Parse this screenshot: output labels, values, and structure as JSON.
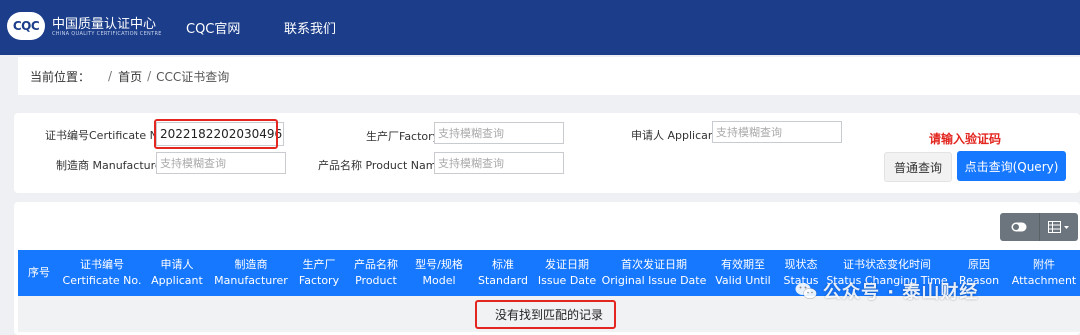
{
  "brand": {
    "logo_text": "CQC",
    "name_cn": "中国质量认证中心",
    "name_en": "CHINA QUALITY CERTIFICATION CENTRE"
  },
  "nav": {
    "items": [
      {
        "label": "CQC官网"
      },
      {
        "label": "联系我们"
      }
    ]
  },
  "breadcrumb": {
    "prefix": "当前位置：",
    "home": "首页",
    "current": "CCC证书查询"
  },
  "form": {
    "cert_no": {
      "label": "证书编号Certificate No.",
      "value": "2022182202030496"
    },
    "factory": {
      "label": "生产厂Factory:",
      "placeholder": "支持模糊查询"
    },
    "applicant": {
      "label": "申请人 Applicant:",
      "placeholder": "支持模糊查询"
    },
    "manufacturer": {
      "label": "制造商 Manufacturer:",
      "placeholder": "支持模糊查询"
    },
    "product": {
      "label": "产品名称 Product Name:",
      "placeholder": "支持模糊查询"
    },
    "captcha_hint": "请输入验证码",
    "btn_normal": "普通查询",
    "btn_query": "点击查询(Query)"
  },
  "toolbar": {
    "icons": [
      "toggle-icon",
      "columns-icon"
    ]
  },
  "table": {
    "columns": [
      {
        "cn": "序号",
        "en": ""
      },
      {
        "cn": "证书编号",
        "en": "Certificate No."
      },
      {
        "cn": "申请人",
        "en": "Applicant"
      },
      {
        "cn": "制造商",
        "en": "Manufacturer"
      },
      {
        "cn": "生产厂",
        "en": "Factory"
      },
      {
        "cn": "产品名称",
        "en": "Product"
      },
      {
        "cn": "型号/规格",
        "en": "Model"
      },
      {
        "cn": "标准",
        "en": "Standard"
      },
      {
        "cn": "发证日期",
        "en": "Issue Date"
      },
      {
        "cn": "首次发证日期",
        "en": "Original Issue Date"
      },
      {
        "cn": "有效期至",
        "en": "Valid Until"
      },
      {
        "cn": "现状态",
        "en": "Status"
      },
      {
        "cn": "证书状态变化时间",
        "en": "Status Changing Time"
      },
      {
        "cn": "原因",
        "en": "Reason"
      },
      {
        "cn": "附件",
        "en": "Attachment"
      }
    ],
    "empty_text": "没有找到匹配的记录"
  },
  "watermark": {
    "text": "公众号 · 泰山财经"
  },
  "colors": {
    "nav_bg": "#1b3d8a",
    "primary": "#1677ff",
    "highlight_red": "#e3261f"
  }
}
